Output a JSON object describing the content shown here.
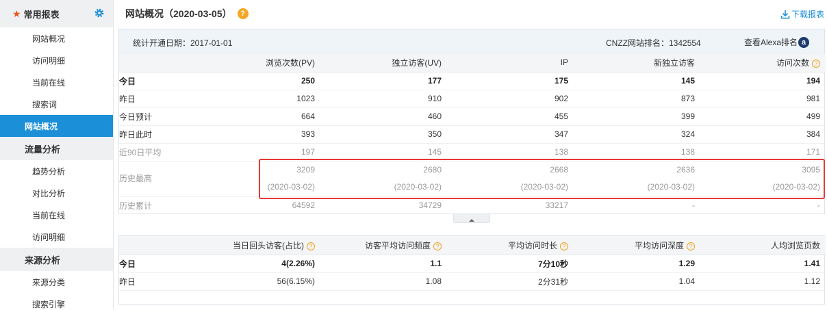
{
  "sidebar": {
    "header": "常用报表",
    "groups": [
      {
        "items": [
          "网站概况",
          "访问明细",
          "当前在线",
          "搜索词"
        ]
      },
      {
        "active": "网站概况"
      },
      {
        "section": "流量分析",
        "items": [
          "趋势分析",
          "对比分析",
          "当前在线",
          "访问明细"
        ]
      },
      {
        "section": "来源分析",
        "items": [
          "来源分类",
          "搜索引擎"
        ]
      }
    ]
  },
  "header": {
    "title": "网站概况（2020-03-05）",
    "help_icon": "?",
    "download_label": "下载报表"
  },
  "info": {
    "start_date": "统计开通日期：2017-01-01",
    "rank": "CNZZ网站排名：1342554",
    "alexa_label": "查看Alexa排名",
    "alexa_icon": "a"
  },
  "table1": {
    "columns": [
      "",
      "浏览次数(PV)",
      "独立访客(UV)",
      "IP",
      "新独立访客",
      "访问次数"
    ],
    "rows": [
      {
        "label": "今日",
        "values": [
          "250",
          "177",
          "175",
          "145",
          "194"
        ]
      },
      {
        "label": "昨日",
        "values": [
          "1023",
          "910",
          "902",
          "873",
          "981"
        ]
      },
      {
        "label": "今日预计",
        "values": [
          "664",
          "460",
          "455",
          "399",
          "499"
        ]
      },
      {
        "label": "昨日此时",
        "values": [
          "393",
          "350",
          "347",
          "324",
          "384"
        ]
      },
      {
        "label": "近90日平均",
        "values": [
          "197",
          "145",
          "138",
          "138",
          "171"
        ]
      },
      {
        "label": "历史最高",
        "values": [
          "3209",
          "2680",
          "2668",
          "2636",
          "3095"
        ],
        "dates": [
          "(2020-03-02)",
          "(2020-03-02)",
          "(2020-03-02)",
          "(2020-03-02)",
          "(2020-03-02)"
        ]
      },
      {
        "label": "历史累计",
        "values": [
          "64592",
          "34729",
          "33217",
          "-",
          "-"
        ]
      }
    ]
  },
  "table2": {
    "columns": [
      "",
      "当日回头访客(占比)",
      "访客平均访问频度",
      "平均访问时长",
      "平均访问深度",
      "人均浏览页数"
    ],
    "rows": [
      {
        "label": "今日",
        "values": [
          "4(2.26%)",
          "1.1",
          "7分10秒",
          "1.29",
          "1.41"
        ]
      },
      {
        "label": "昨日",
        "values": [
          "56(6.15%)",
          "1.08",
          "2分31秒",
          "1.04",
          "1.12"
        ]
      }
    ]
  },
  "colors": {
    "accent": "#1b8fd8",
    "highlight_box": "#e53935",
    "help": "#f5a623"
  }
}
